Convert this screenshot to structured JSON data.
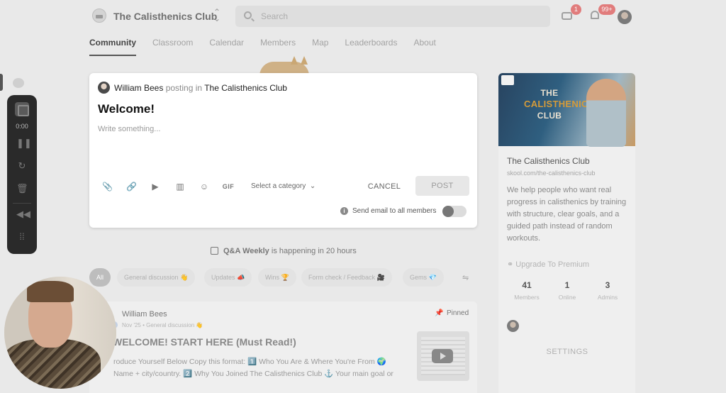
{
  "header": {
    "club_name": "The Calisthenics Club",
    "search_placeholder": "Search",
    "chat_badge": "1",
    "notifications_badge": "99+"
  },
  "tabs": [
    "Community",
    "Classroom",
    "Calendar",
    "Members",
    "Map",
    "Leaderboards",
    "About"
  ],
  "recorder": {
    "time": "0:00"
  },
  "composer": {
    "author": "William Bees",
    "posting_in": "posting in",
    "club": "The Calisthenics Club",
    "title": "Welcome!",
    "body_placeholder": "Write something...",
    "gif_label": "GIF",
    "category_label": "Select a category",
    "cancel_label": "CANCEL",
    "post_label": "POST",
    "email_label": "Send email to all members",
    "email_toggle_on": false
  },
  "event": {
    "name": "Q&A Weekly",
    "text": "is happening in 20 hours"
  },
  "filters": [
    "All",
    "General discussion 👋",
    "Updates 📣",
    "Wins 🏆",
    "Form check / Feedback 🎥",
    "Gems 💎"
  ],
  "post": {
    "author": "William Bees",
    "meta": "Nov '25 • General discussion 👋",
    "pinned_label": "Pinned",
    "title": "WELCOME! START HERE (Must Read!)",
    "excerpt": "roduce Yourself Below Copy this format: 1️⃣ Who You Are & Where You're From 🌍 Name + city/country. 2️⃣ Why You Joined The Calisthenics Club ⚓ Your main goal or"
  },
  "sidebar": {
    "banner_lines": [
      "THE",
      "CALISTHENICS",
      "CLUB"
    ],
    "name": "The Calisthenics Club",
    "url": "skool.com/the-calisthenics-club",
    "description": "We help people who want real progress in calisthenics by training with structure, clear goals, and a guided path instead of random workouts.",
    "upgrade_label": "Upgrade To Premium",
    "stats": [
      {
        "value": "41",
        "label": "Members"
      },
      {
        "value": "1",
        "label": "Online"
      },
      {
        "value": "3",
        "label": "Admins"
      }
    ],
    "settings_label": "SETTINGS"
  },
  "colors": {
    "accent": "#555555",
    "badge": "#e06a6a",
    "overlay": "#e9e9e9"
  }
}
